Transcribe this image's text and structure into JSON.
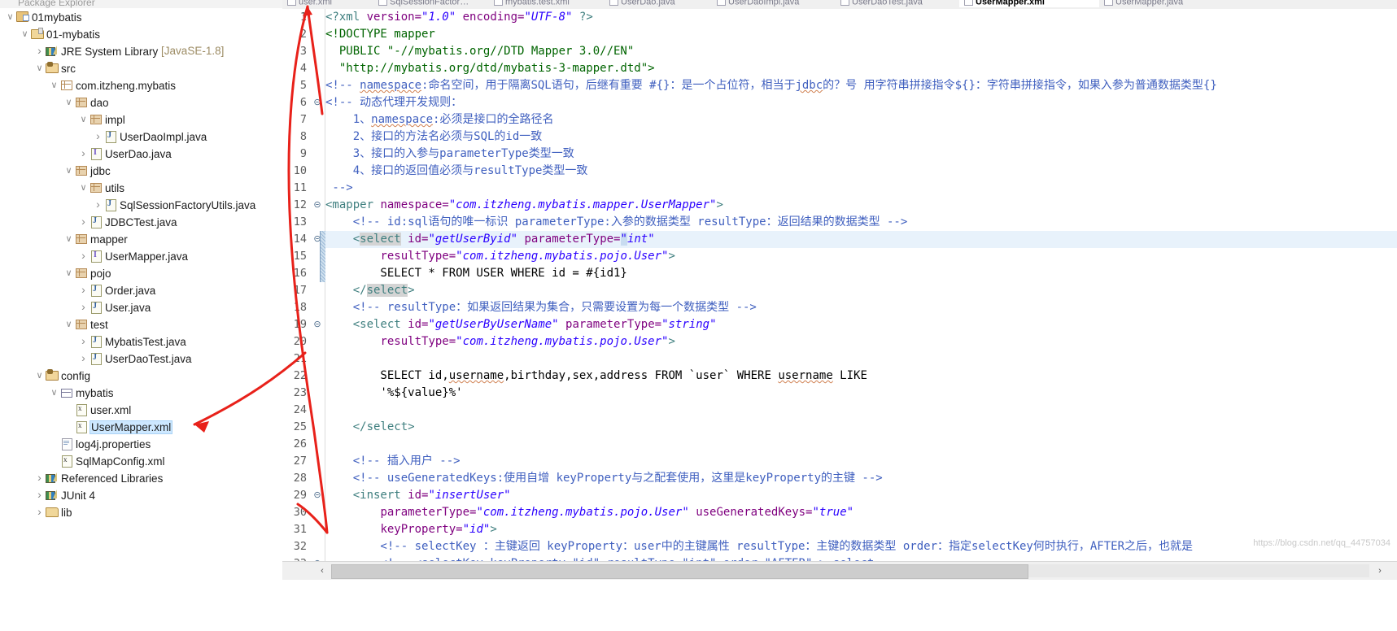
{
  "explorer": {
    "title": "Package Explorer",
    "tree": [
      {
        "label": "01mybatis",
        "indent": 0,
        "twisty": "open",
        "icon": "project-icon"
      },
      {
        "label": "01-mybatis",
        "indent": 1,
        "twisty": "open",
        "icon": "java-project-icon"
      },
      {
        "label": "JRE System Library",
        "sublabel": "[JavaSE-1.8]",
        "indent": 2,
        "twisty": "closed",
        "icon": "library-icon"
      },
      {
        "label": "src",
        "indent": 2,
        "twisty": "open",
        "icon": "source-folder-icon"
      },
      {
        "label": "com.itzheng.mybatis",
        "indent": 3,
        "twisty": "open",
        "icon": "package-empty-icon"
      },
      {
        "label": "dao",
        "indent": 4,
        "twisty": "open",
        "icon": "package-icon"
      },
      {
        "label": "impl",
        "indent": 5,
        "twisty": "open",
        "icon": "package-icon"
      },
      {
        "label": "UserDaoImpl.java",
        "indent": 6,
        "twisty": "closed",
        "icon": "java-class-icon"
      },
      {
        "label": "UserDao.java",
        "indent": 5,
        "twisty": "closed",
        "icon": "java-interface-icon"
      },
      {
        "label": "jdbc",
        "indent": 4,
        "twisty": "open",
        "icon": "package-icon"
      },
      {
        "label": "utils",
        "indent": 5,
        "twisty": "open",
        "icon": "package-icon"
      },
      {
        "label": "SqlSessionFactoryUtils.java",
        "indent": 6,
        "twisty": "closed",
        "icon": "java-class-icon"
      },
      {
        "label": "JDBCTest.java",
        "indent": 5,
        "twisty": "closed",
        "icon": "java-class-icon"
      },
      {
        "label": "mapper",
        "indent": 4,
        "twisty": "open",
        "icon": "package-icon"
      },
      {
        "label": "UserMapper.java",
        "indent": 5,
        "twisty": "closed",
        "icon": "java-interface-icon"
      },
      {
        "label": "pojo",
        "indent": 4,
        "twisty": "open",
        "icon": "package-icon"
      },
      {
        "label": "Order.java",
        "indent": 5,
        "twisty": "closed",
        "icon": "java-class-icon"
      },
      {
        "label": "User.java",
        "indent": 5,
        "twisty": "closed",
        "icon": "java-class-icon"
      },
      {
        "label": "test",
        "indent": 4,
        "twisty": "open",
        "icon": "package-icon"
      },
      {
        "label": "MybatisTest.java",
        "indent": 5,
        "twisty": "closed",
        "icon": "java-class-icon"
      },
      {
        "label": "UserDaoTest.java",
        "indent": 5,
        "twisty": "closed",
        "icon": "java-class-icon"
      },
      {
        "label": "config",
        "indent": 2,
        "twisty": "open",
        "icon": "source-folder-icon"
      },
      {
        "label": "mybatis",
        "indent": 3,
        "twisty": "open",
        "icon": "package-flat-icon"
      },
      {
        "label": "user.xml",
        "indent": 4,
        "twisty": "none",
        "icon": "xml-file-icon"
      },
      {
        "label": "UserMapper.xml",
        "indent": 4,
        "twisty": "none",
        "icon": "xml-file-icon",
        "selected": true
      },
      {
        "label": "log4j.properties",
        "indent": 3,
        "twisty": "none",
        "icon": "text-file-icon"
      },
      {
        "label": "SqlMapConfig.xml",
        "indent": 3,
        "twisty": "none",
        "icon": "xml-file-icon"
      },
      {
        "label": "Referenced Libraries",
        "indent": 2,
        "twisty": "closed",
        "icon": "library-icon"
      },
      {
        "label": "JUnit 4",
        "indent": 2,
        "twisty": "closed",
        "icon": "library-icon"
      },
      {
        "label": "lib",
        "indent": 2,
        "twisty": "closed",
        "icon": "folder-icon"
      }
    ]
  },
  "editor": {
    "tabs": [
      {
        "label": "user.xml",
        "active": false
      },
      {
        "label": "SqlSessionFactor…",
        "active": false
      },
      {
        "label": "mybatis.test.xml",
        "active": false
      },
      {
        "label": "UserDao.java",
        "active": false
      },
      {
        "label": "UserDaoImpl.java",
        "active": false
      },
      {
        "label": "UserDaoTest.java",
        "active": false
      },
      {
        "label": "UserMapper.xml",
        "active": true
      },
      {
        "label": "UserMapper.java",
        "active": false
      }
    ],
    "first_line": 1,
    "last_line": 33,
    "highlight_line": 14,
    "fold_lines": [
      6,
      12,
      14,
      19,
      29,
      33
    ],
    "change_bar_lines": [
      14,
      15,
      16
    ],
    "lines": [
      {
        "n": 1,
        "segments": [
          {
            "t": "<?xml ",
            "c": "pi"
          },
          {
            "t": "version=",
            "c": "attr"
          },
          {
            "t": "\"1.0\"",
            "c": "val"
          },
          {
            "t": " ",
            "c": "plain"
          },
          {
            "t": "encoding=",
            "c": "attr"
          },
          {
            "t": "\"UTF-8\"",
            "c": "val"
          },
          {
            "t": " ?>",
            "c": "pi"
          }
        ]
      },
      {
        "n": 2,
        "segments": [
          {
            "t": "<!DOCTYPE mapper",
            "c": "doctype"
          }
        ]
      },
      {
        "n": 3,
        "segments": [
          {
            "t": "  PUBLIC \"-//mybatis.org//DTD Mapper 3.0//EN\"",
            "c": "doctype"
          }
        ]
      },
      {
        "n": 4,
        "segments": [
          {
            "t": "  \"http://mybatis.org/dtd/mybatis-3-mapper.dtd\">",
            "c": "doctype"
          }
        ]
      },
      {
        "n": 5,
        "segments": [
          {
            "t": "<!-- ",
            "c": "cmt"
          },
          {
            "t": "namespace",
            "c": "cmt squig"
          },
          {
            "t": ":命名空间，用于隔离SQL语句，后继有重要 #{}：是一个占位符，相当于",
            "c": "cmt"
          },
          {
            "t": "jdbc",
            "c": "cmt squig"
          },
          {
            "t": "的？号 用字符串拼接指令${}：字符串拼接指令，如果入参为普通数据类型{}",
            "c": "cmt"
          }
        ]
      },
      {
        "n": 6,
        "segments": [
          {
            "t": "<!-- 动态代理开发规则：",
            "c": "cmt"
          }
        ]
      },
      {
        "n": 7,
        "segments": [
          {
            "t": "    1、",
            "c": "cmt"
          },
          {
            "t": "namespace",
            "c": "cmt squig"
          },
          {
            "t": ":必须是接口的全路径名",
            "c": "cmt"
          }
        ]
      },
      {
        "n": 8,
        "segments": [
          {
            "t": "    2、接口的方法名必须与SQL的id一致",
            "c": "cmt"
          }
        ]
      },
      {
        "n": 9,
        "segments": [
          {
            "t": "    3、接口的入参与parameterType类型一致",
            "c": "cmt"
          }
        ]
      },
      {
        "n": 10,
        "segments": [
          {
            "t": "    4、接口的返回值必须与resultType类型一致",
            "c": "cmt"
          }
        ]
      },
      {
        "n": 11,
        "segments": [
          {
            "t": " -->",
            "c": "cmt"
          }
        ]
      },
      {
        "n": 12,
        "segments": [
          {
            "t": "<mapper ",
            "c": "tag"
          },
          {
            "t": "namespace=",
            "c": "attr"
          },
          {
            "t": "\"com.itzheng.mybatis.mapper.UserMapper\"",
            "c": "val"
          },
          {
            "t": ">",
            "c": "tag"
          }
        ]
      },
      {
        "n": 13,
        "segments": [
          {
            "t": "    <!-- id:sql语句的唯一标识 parameterType:入参的数据类型 resultType：返回结果的数据类型 -->",
            "c": "cmt"
          }
        ]
      },
      {
        "n": 14,
        "segments": [
          {
            "t": "    <",
            "c": "tag"
          },
          {
            "t": "select",
            "c": "tag sel-bg"
          },
          {
            "t": " ",
            "c": "plain"
          },
          {
            "t": "id=",
            "c": "attr"
          },
          {
            "t": "\"getUserByid\"",
            "c": "val"
          },
          {
            "t": " ",
            "c": "plain"
          },
          {
            "t": "parameterType=",
            "c": "attr"
          },
          {
            "t": "\"",
            "c": "val cursor-box"
          },
          {
            "t": "int\"",
            "c": "val"
          }
        ]
      },
      {
        "n": 15,
        "segments": [
          {
            "t": "        ",
            "c": "plain"
          },
          {
            "t": "resultType=",
            "c": "attr"
          },
          {
            "t": "\"com.itzheng.mybatis.pojo.User\"",
            "c": "val"
          },
          {
            "t": ">",
            "c": "tag"
          }
        ]
      },
      {
        "n": 16,
        "segments": [
          {
            "t": "        SELECT * FROM USER WHERE id = #{id1}",
            "c": "plain"
          }
        ]
      },
      {
        "n": 17,
        "segments": [
          {
            "t": "    </",
            "c": "tag"
          },
          {
            "t": "select",
            "c": "tag sel-bg"
          },
          {
            "t": ">",
            "c": "tag"
          }
        ]
      },
      {
        "n": 18,
        "segments": [
          {
            "t": "    <!-- resultType：如果返回结果为集合，只需要设置为每一个数据类型 -->",
            "c": "cmt"
          }
        ]
      },
      {
        "n": 19,
        "segments": [
          {
            "t": "    <select ",
            "c": "tag"
          },
          {
            "t": "id=",
            "c": "attr"
          },
          {
            "t": "\"getUserByUserName\"",
            "c": "val"
          },
          {
            "t": " ",
            "c": "plain"
          },
          {
            "t": "parameterType=",
            "c": "attr"
          },
          {
            "t": "\"string\"",
            "c": "val"
          }
        ]
      },
      {
        "n": 20,
        "segments": [
          {
            "t": "        ",
            "c": "plain"
          },
          {
            "t": "resultType=",
            "c": "attr"
          },
          {
            "t": "\"com.itzheng.mybatis.pojo.User\"",
            "c": "val"
          },
          {
            "t": ">",
            "c": "tag"
          }
        ]
      },
      {
        "n": 21,
        "segments": [
          {
            "t": "",
            "c": "plain"
          }
        ]
      },
      {
        "n": 22,
        "segments": [
          {
            "t": "        SELECT id,",
            "c": "plain"
          },
          {
            "t": "username",
            "c": "plain squig"
          },
          {
            "t": ",birthday,sex,address FROM `user` WHERE ",
            "c": "plain"
          },
          {
            "t": "username",
            "c": "plain squig"
          },
          {
            "t": " LIKE",
            "c": "plain"
          }
        ]
      },
      {
        "n": 23,
        "segments": [
          {
            "t": "        '%${value}%'",
            "c": "plain"
          }
        ]
      },
      {
        "n": 24,
        "segments": [
          {
            "t": "",
            "c": "plain"
          }
        ]
      },
      {
        "n": 25,
        "segments": [
          {
            "t": "    </select>",
            "c": "tag"
          }
        ]
      },
      {
        "n": 26,
        "segments": [
          {
            "t": "",
            "c": "plain"
          }
        ]
      },
      {
        "n": 27,
        "segments": [
          {
            "t": "    <!-- 插入用户 -->",
            "c": "cmt"
          }
        ]
      },
      {
        "n": 28,
        "segments": [
          {
            "t": "    <!-- useGeneratedKeys:使用自增 keyProperty与之配套使用，这里是keyProperty的主键 -->",
            "c": "cmt"
          }
        ]
      },
      {
        "n": 29,
        "segments": [
          {
            "t": "    <insert ",
            "c": "tag"
          },
          {
            "t": "id=",
            "c": "attr"
          },
          {
            "t": "\"insertUser\"",
            "c": "val"
          }
        ]
      },
      {
        "n": 30,
        "segments": [
          {
            "t": "        ",
            "c": "plain"
          },
          {
            "t": "parameterType=",
            "c": "attr"
          },
          {
            "t": "\"com.itzheng.mybatis.pojo.User\"",
            "c": "val"
          },
          {
            "t": " ",
            "c": "plain"
          },
          {
            "t": "useGeneratedKeys=",
            "c": "attr"
          },
          {
            "t": "\"true\"",
            "c": "val"
          }
        ]
      },
      {
        "n": 31,
        "segments": [
          {
            "t": "        ",
            "c": "plain"
          },
          {
            "t": "keyProperty=",
            "c": "attr"
          },
          {
            "t": "\"id\"",
            "c": "val"
          },
          {
            "t": ">",
            "c": "tag"
          }
        ]
      },
      {
        "n": 32,
        "segments": [
          {
            "t": "        <!-- selectKey ：主键返回 keyProperty：user中的主键属性 resultType：主键的数据类型 order：指定selectKey何时执行，AFTER之后，也就是",
            "c": "cmt"
          }
        ]
      },
      {
        "n": 33,
        "segments": [
          {
            "t": "        <!-- <selectKey keyProperty=\"id\" resultType=\"int\" order=\"AFTER\" > select",
            "c": "cmt"
          }
        ]
      }
    ],
    "scrollbar": {
      "left_arrow": "‹",
      "right_arrow": "›"
    }
  },
  "watermark": "https://blog.csdn.net/qq_44757034",
  "colors": {
    "selection": "#cde8ff",
    "annotation": "#e8211a",
    "tag": "#3f7f7f",
    "attr": "#7f007f",
    "value": "#2a00ff",
    "comment": "#3f5fbf",
    "doctype": "#006400"
  }
}
